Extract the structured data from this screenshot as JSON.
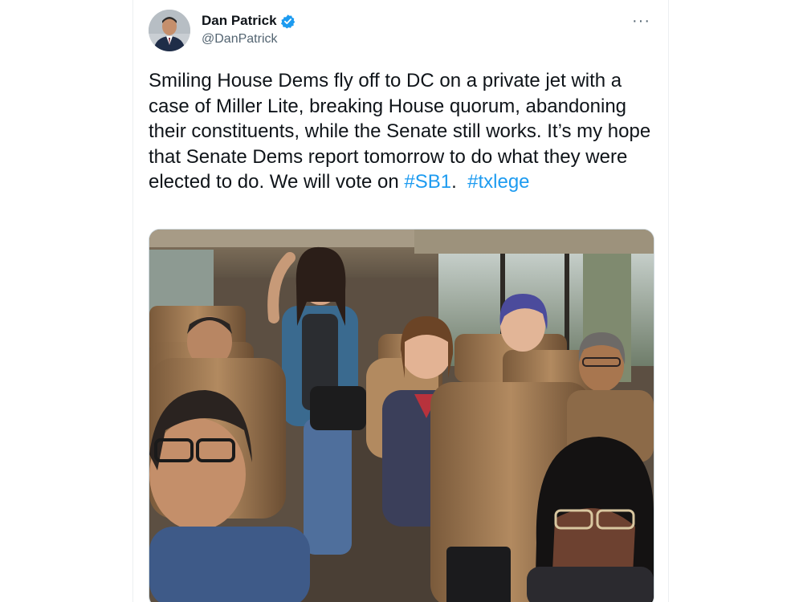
{
  "author": {
    "display_name": "Dan Patrick",
    "handle": "@DanPatrick",
    "verified": true,
    "avatar_icon": "profile-photo",
    "verified_icon": "verified-badge-icon",
    "verified_color": "#1d9bf0"
  },
  "menu": {
    "more_label": "···"
  },
  "tweet": {
    "text_main": "Smiling House Dems fly off to DC on a private jet with a case of Miller Lite, breaking House quorum, abandoning their constituents, while the Senate still works. It’s my hope that Senate Dems report tomorrow to do what they were elected to do. We will vote on ",
    "hashtag_1": "#SB1",
    "separator": ".  ",
    "hashtag_2": "#txlege",
    "hashtag_color": "#1d9bf0"
  },
  "media": {
    "description_icon": "group-photo-on-bus"
  }
}
